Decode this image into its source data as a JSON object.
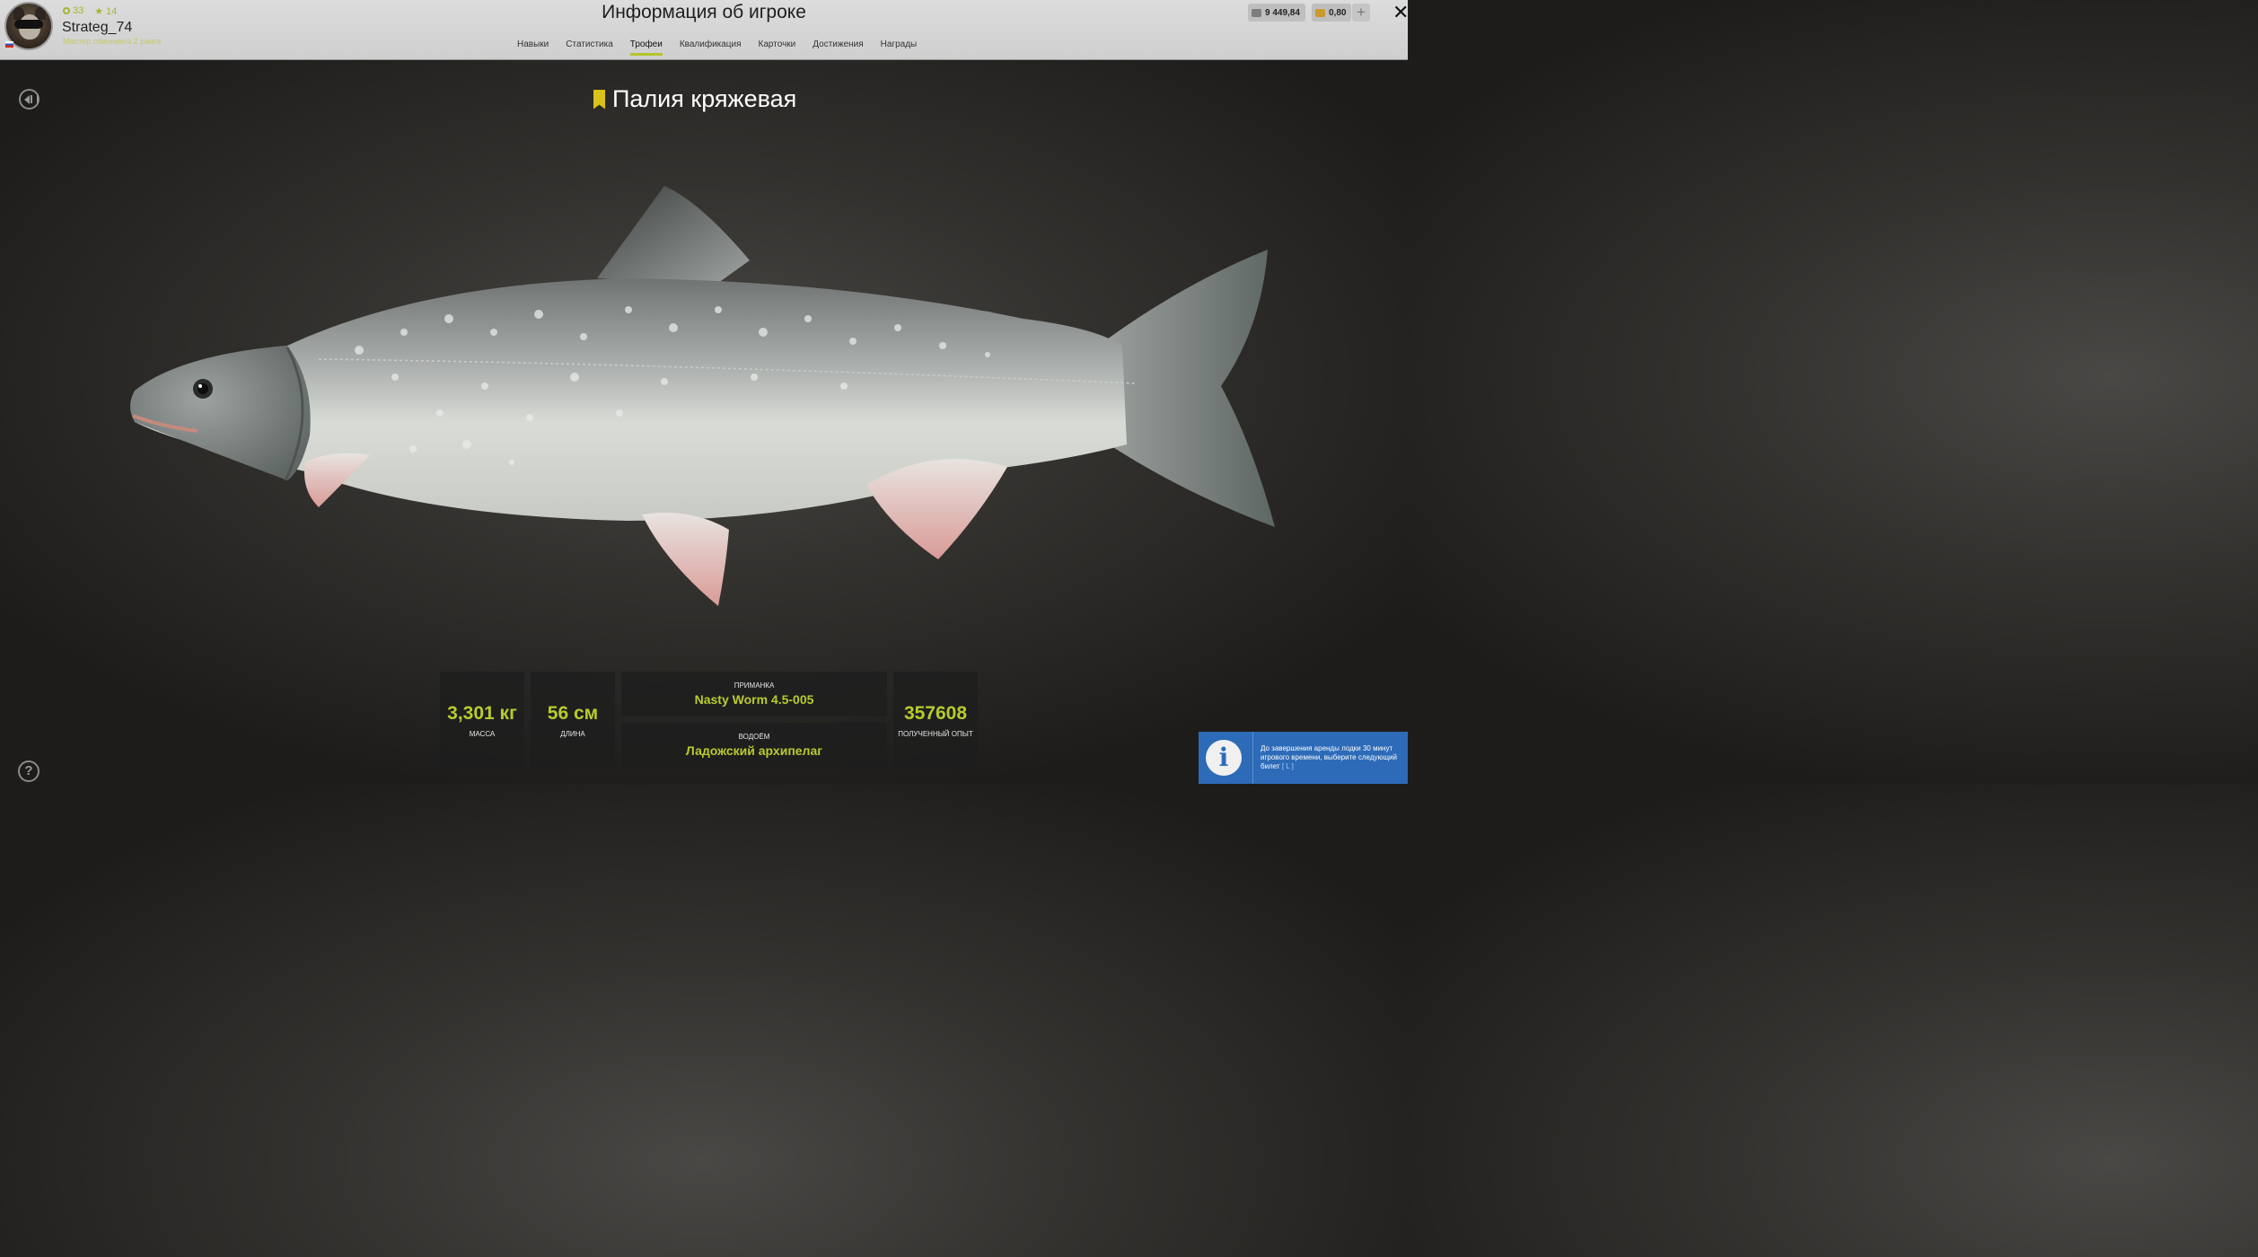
{
  "header": {
    "title": "Информация об игроке",
    "player": {
      "name": "Strateg_74",
      "rank_text": "Мастер спиннинга 2 ранга",
      "level": "33",
      "stars": "14"
    },
    "tabs": [
      {
        "label": "Навыки"
      },
      {
        "label": "Статистика"
      },
      {
        "label": "Трофеи",
        "active": true
      },
      {
        "label": "Квалификация"
      },
      {
        "label": "Карточки"
      },
      {
        "label": "Достижения"
      },
      {
        "label": "Награды"
      }
    ],
    "currency": {
      "silver": "9 449,84",
      "gold": "0,80",
      "add_label": "+"
    },
    "close_label": "✕"
  },
  "trophy": {
    "name": "Палия кряжевая",
    "mass_value": "3,301 кг",
    "mass_label": "МАССА",
    "length_value": "56 см",
    "length_label": "ДЛИНА",
    "bait_label": "ПРИМАНКА",
    "bait_value": "Nasty Worm 4.5-005",
    "water_label": "ВОДОЁМ",
    "water_value": "Ладожский архипелаг",
    "xp_value": "357608",
    "xp_label": "ПОЛУЧЕННЫЙ ОПЫТ"
  },
  "help_label": "?",
  "notification": {
    "icon": "info-icon",
    "text": "До завершения аренды лодки 30 минут игрового времени, выберите следующий билет",
    "key": "[ L ]"
  },
  "colors": {
    "accent": "#b9cb2d",
    "bookmark": "#d9c21a",
    "toast": "#2d6bb8"
  }
}
